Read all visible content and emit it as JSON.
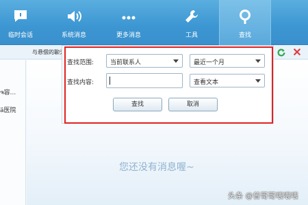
{
  "toolbar": {
    "items": [
      {
        "label": "临时会话",
        "icon": "chat-bubble-icon"
      },
      {
        "label": "系统消息",
        "icon": "speaker-icon"
      },
      {
        "label": "更多消息",
        "icon": "more-dots-icon"
      },
      {
        "label": "工具",
        "icon": "wrench-icon"
      },
      {
        "label": "查找",
        "icon": "search-icon",
        "active": true
      }
    ]
  },
  "subbar": {
    "text": "与悬偿的聊天记录"
  },
  "sidebar": {
    "items": [
      "ຈ容...",
      "ä医院"
    ]
  },
  "search_panel": {
    "scope_label": "查找范围:",
    "scope_value": "当前联系人",
    "range_value": "最近一个月",
    "content_label": "查找内容:",
    "content_value": "",
    "view_value": "查看文本",
    "search_button": "查找",
    "cancel_button": "取消"
  },
  "empty_message": "您还没有消息喔~",
  "watermark": "头条 @曾哥哥喂喂喂",
  "colors": {
    "toolbar": "#3c96d2",
    "highlight": "#e02020",
    "refresh": "#2fa84f",
    "close": "#e03c3c"
  }
}
